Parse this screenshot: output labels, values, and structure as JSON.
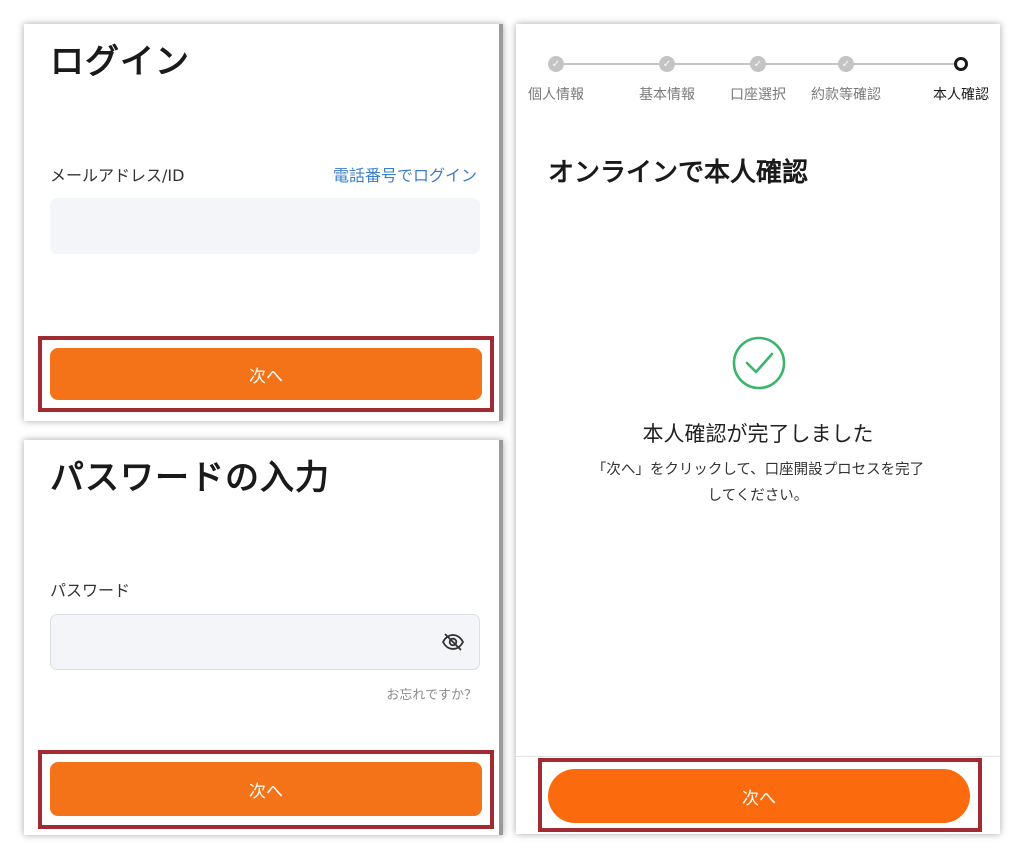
{
  "login": {
    "title": "ログイン",
    "email_label": "メールアドレス/ID",
    "phone_login_link": "電話番号でログイン",
    "email_value": "",
    "next_button": "次へ"
  },
  "password": {
    "title": "パスワードの入力",
    "password_label": "パスワード",
    "password_value": "",
    "forgot_link": "お忘れですか？",
    "next_button": "次へ"
  },
  "verify": {
    "steps": [
      {
        "label": "個人情報",
        "status": "completed"
      },
      {
        "label": "基本情報",
        "status": "completed"
      },
      {
        "label": "口座選択",
        "status": "completed"
      },
      {
        "label": "約款等確認",
        "status": "completed"
      },
      {
        "label": "本人確認",
        "status": "current"
      }
    ],
    "title": "オンラインで本人確認",
    "done_title": "本人確認が完了しました",
    "done_desc_line1": "「次へ」をクリックして、口座開設プロセスを完了",
    "done_desc_line2": "してください。",
    "next_button": "次へ"
  },
  "colors": {
    "accent_orange": "#f47218",
    "highlight_red": "#a02b32",
    "link_blue": "#3b7fc7",
    "success_green": "#3cb46e"
  }
}
